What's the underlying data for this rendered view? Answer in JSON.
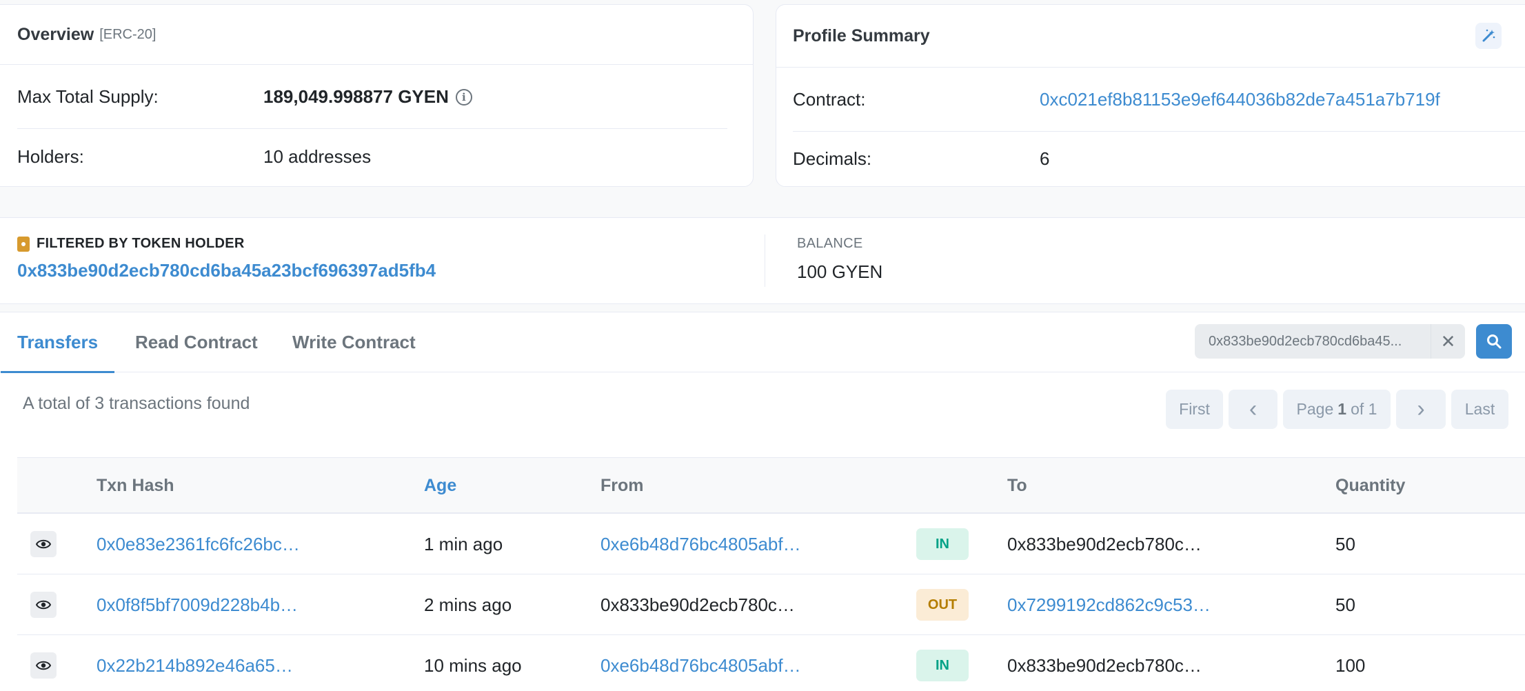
{
  "overview": {
    "title": "Overview",
    "tag": "[ERC-20]",
    "max_supply_label": "Max Total Supply:",
    "max_supply_value": "189,049.998877 GYEN",
    "info_glyph": "i",
    "holders_label": "Holders:",
    "holders_value": "10 addresses"
  },
  "profile": {
    "title": "Profile Summary",
    "edit_icon": "magic-wand-icon",
    "contract_label": "Contract:",
    "contract_value": "0xc021ef8b81153e9ef644036b82de7a451a7b719f",
    "decimals_label": "Decimals:",
    "decimals_value": "6"
  },
  "filter": {
    "heading": "FILTERED BY TOKEN HOLDER",
    "address": "0x833be90d2ecb780cd6ba45a23bcf696397ad5fb4",
    "balance_label": "BALANCE",
    "balance_value": "100 GYEN"
  },
  "tabs": {
    "transfers": "Transfers",
    "read": "Read Contract",
    "write": "Write Contract"
  },
  "search": {
    "value": "0x833be90d2ecb780cd6ba45...",
    "clear_glyph": "✕"
  },
  "summary": "A total of 3 transactions found",
  "pagination": {
    "first": "First",
    "prev": "‹",
    "page_prefix": "Page",
    "page_current": "1",
    "page_of": "of 1",
    "next": "›",
    "last": "Last"
  },
  "table": {
    "headers": {
      "txn_hash": "Txn Hash",
      "age": "Age",
      "from": "From",
      "to": "To",
      "quantity": "Quantity"
    },
    "rows": [
      {
        "hash": "0x0e83e2361fc6fc26bc…",
        "age": "1 min ago",
        "from": "0xe6b48d76bc4805abf…",
        "direction": "IN",
        "to": "0x833be90d2ecb780c…",
        "quantity": "50"
      },
      {
        "hash": "0x0f8f5bf7009d228b4b…",
        "age": "2 mins ago",
        "from": "0x833be90d2ecb780c…",
        "direction": "OUT",
        "to": "0x7299192cd862c9c53…",
        "quantity": "50"
      },
      {
        "hash": "0x22b214b892e46a65…",
        "age": "10 mins ago",
        "from": "0xe6b48d76bc4805abf…",
        "direction": "IN",
        "to": "0x833be90d2ecb780c…",
        "quantity": "100"
      }
    ]
  },
  "colors": {
    "link": "#3d8bd0",
    "in_badge_bg": "#daf4eb",
    "in_badge_text": "#00a186",
    "out_badge_bg": "#fbecd6",
    "out_badge_text": "#b47d00",
    "holder_icon": "#d79a2e"
  }
}
